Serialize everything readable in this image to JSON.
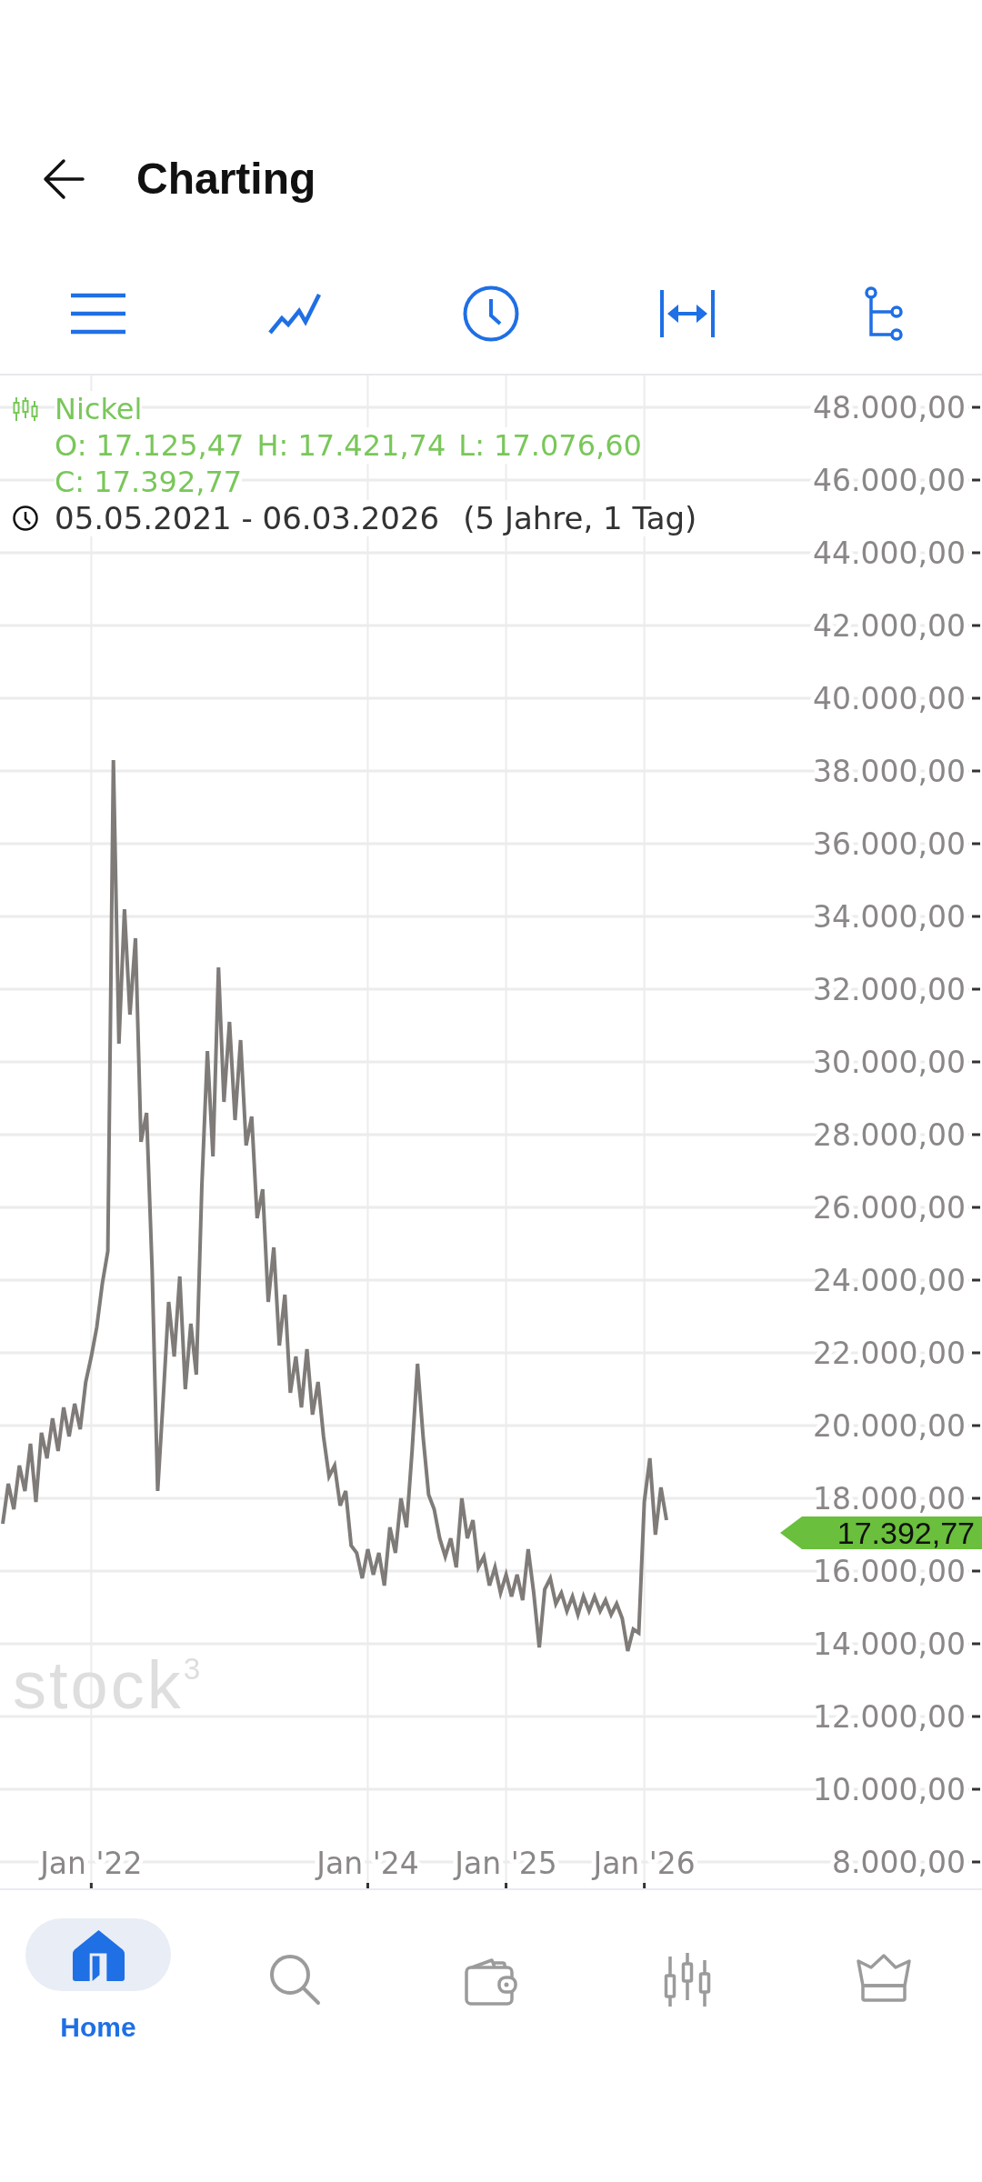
{
  "header": {
    "title": "Charting"
  },
  "chart": {
    "legend": {
      "name": "Nickel",
      "values": [
        "O: 17.125,47",
        "H: 17.421,74",
        "L: 17.076,60",
        "C: 17.392,77"
      ],
      "date_range": "05.05.2021 - 06.03.2026",
      "period": "(5 Jahre, 1 Tag)"
    },
    "chart_logo": "stock$^{3}$",
    "chart_data": {
      "type": "line",
      "grid": true,
      "categories": [
        null,
        null,
        null,
        null,
        null,
        null,
        null,
        null,
        null,
        null,
        null,
        null,
        null,
        null,
        null,
        null,
        "Jan '22",
        null,
        null,
        null,
        null,
        null,
        null,
        null,
        null,
        null,
        null,
        null,
        null,
        null,
        null,
        null,
        null,
        null,
        null,
        null,
        null,
        null,
        null,
        null,
        null,
        null,
        null,
        null,
        null,
        null,
        null,
        null,
        null,
        null,
        null,
        null,
        null,
        null,
        null,
        null,
        null,
        null,
        null,
        null,
        null,
        null,
        null,
        null,
        null,
        null,
        "Jan '24",
        null,
        null,
        null,
        null,
        null,
        null,
        null,
        null,
        null,
        null,
        null,
        null,
        null,
        null,
        null,
        null,
        null,
        null,
        null,
        null,
        null,
        null,
        null,
        null,
        "Jan '25",
        null,
        null,
        null,
        null,
        null,
        null,
        null,
        null,
        null,
        null,
        null,
        null,
        null,
        null,
        null,
        null,
        null,
        null,
        null,
        null,
        null,
        null,
        null,
        null,
        "Jan '26",
        null,
        null,
        null,
        null
      ],
      "series": [
        {
          "color": "#7f7b79",
          "values": [
            17300,
            18400,
            17700,
            18900,
            18200,
            19500,
            17900,
            19800,
            19100,
            20200,
            19300,
            20500,
            19700,
            20600,
            19900,
            21200,
            21900,
            22700,
            23900,
            24800,
            38300,
            30500,
            34200,
            31300,
            33400,
            27800,
            28600,
            24300,
            18200,
            20700,
            23400,
            21900,
            24100,
            21000,
            22800,
            21400,
            26600,
            30300,
            27400,
            32600,
            28900,
            31100,
            28400,
            30600,
            27700,
            28500,
            25700,
            26500,
            23400,
            24900,
            22200,
            23600,
            20900,
            21900,
            20500,
            22100,
            20300,
            21200,
            19700,
            18600,
            18900,
            17800,
            18200,
            16700,
            16500,
            15800,
            16600,
            15900,
            16500,
            15600,
            17200,
            16500,
            18000,
            17200,
            19300,
            21700,
            19700,
            18100,
            17700,
            16900,
            16400,
            16900,
            16100,
            18000,
            16900,
            17400,
            16100,
            16400,
            15600,
            16100,
            15400,
            15900,
            15300,
            15900,
            15200,
            16600,
            15400,
            13900,
            15500,
            15800,
            15100,
            15400,
            14900,
            15300,
            14800,
            15300,
            14900,
            15300,
            14900,
            15200,
            14800,
            15100,
            14700,
            13800,
            14400,
            14300,
            17900,
            19100,
            17000,
            18300,
            17400
          ]
        }
      ],
      "ylim": [
        7275,
        48875
      ],
      "yticks": [
        {
          "value": 48000,
          "label": "48.000,00"
        },
        {
          "value": 46000,
          "label": "46.000,00"
        },
        {
          "value": 44000,
          "label": "44.000,00"
        },
        {
          "value": 42000,
          "label": "42.000,00"
        },
        {
          "value": 40000,
          "label": "40.000,00"
        },
        {
          "value": 38000,
          "label": "38.000,00"
        },
        {
          "value": 36000,
          "label": "36.000,00"
        },
        {
          "value": 34000,
          "label": "34.000,00"
        },
        {
          "value": 32000,
          "label": "32.000,00"
        },
        {
          "value": 30000,
          "label": "30.000,00"
        },
        {
          "value": 28000,
          "label": "28.000,00"
        },
        {
          "value": 26000,
          "label": "26.000,00"
        },
        {
          "value": 24000,
          "label": "24.000,00"
        },
        {
          "value": 22000,
          "label": "22.000,00"
        },
        {
          "value": 20000,
          "label": "20.000,00"
        },
        {
          "value": 18000,
          "label": "18.000,00"
        },
        {
          "value": 16000,
          "label": "16.000,00"
        },
        {
          "value": 14000,
          "label": "14.000,00"
        },
        {
          "value": 12000,
          "label": "12.000,00"
        },
        {
          "value": 10000,
          "label": "10.000,00"
        },
        {
          "value": 8000,
          "label": "8.000,00"
        }
      ],
      "annotations": [
        "17.392,77"
      ]
    }
  },
  "bottom_nav": [
    {
      "label": "Home",
      "selected": true
    },
    {
      "selected": false
    },
    {
      "selected": false
    },
    {
      "selected": false
    },
    {
      "selected": false
    }
  ]
}
